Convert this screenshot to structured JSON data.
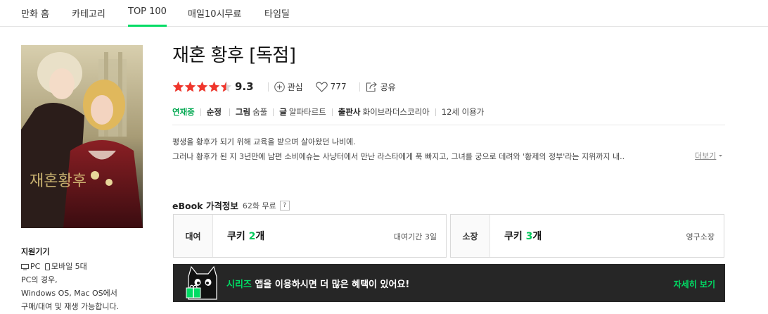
{
  "nav": {
    "tabs": [
      {
        "label": "만화 홈"
      },
      {
        "label": "카테고리"
      },
      {
        "label": "TOP 100"
      },
      {
        "label": "매일10시무료"
      },
      {
        "label": "타임딜"
      }
    ]
  },
  "cover": {
    "title_art": "재혼황후"
  },
  "title": "재혼 황후 [독점]",
  "rating": {
    "score": "9.3",
    "stars": 4.5
  },
  "actions": {
    "follow": "관심",
    "likes": "777",
    "share": "공유"
  },
  "info": {
    "status": "연재중",
    "type": "순정",
    "art_label": "그림",
    "art_value": "숨풀",
    "story_label": "글",
    "story_value": "알파타르트",
    "publisher_label": "출판사",
    "publisher_value": "화이브라더스코리아",
    "age": "12세 이용가"
  },
  "description": {
    "line1": "평생을 황후가 되기 위해 교육을 받으며 살아왔던 나비에.",
    "line2": "그러나 황후가 된 지 3년만에 남편 소비에슈는 사냥터에서 만난 라스타에게 푹 빠지고, 그녀를 궁으로 데려와 '황제의 정부'라는 지위까지 내..",
    "more": "더보기"
  },
  "price": {
    "header": "eBook 가격정보",
    "free": "62화 무료",
    "help": "?",
    "rent": {
      "kind": "대여",
      "prefix": "쿠키 ",
      "count": "2",
      "suffix": "개",
      "note": "대여기간 3일"
    },
    "own": {
      "kind": "소장",
      "prefix": "쿠키 ",
      "count": "3",
      "suffix": "개",
      "note": "영구소장"
    }
  },
  "banner": {
    "highlight": "시리즈",
    "text": " 앱을 이용하시면 더 많은 혜택이 있어요!",
    "detail": "자세히 보기"
  },
  "support": {
    "head": "지원기기",
    "devices_pc": "PC",
    "devices_mobile": "모바일 5대",
    "line1": "PC의 경우,",
    "line2": "Windows OS, Mac OS에서",
    "line3": "구매/대여 및 재생 가능합니다."
  },
  "colors": {
    "accent": "#00dc64",
    "star": "#f0362c",
    "banner_bg": "#262626"
  }
}
